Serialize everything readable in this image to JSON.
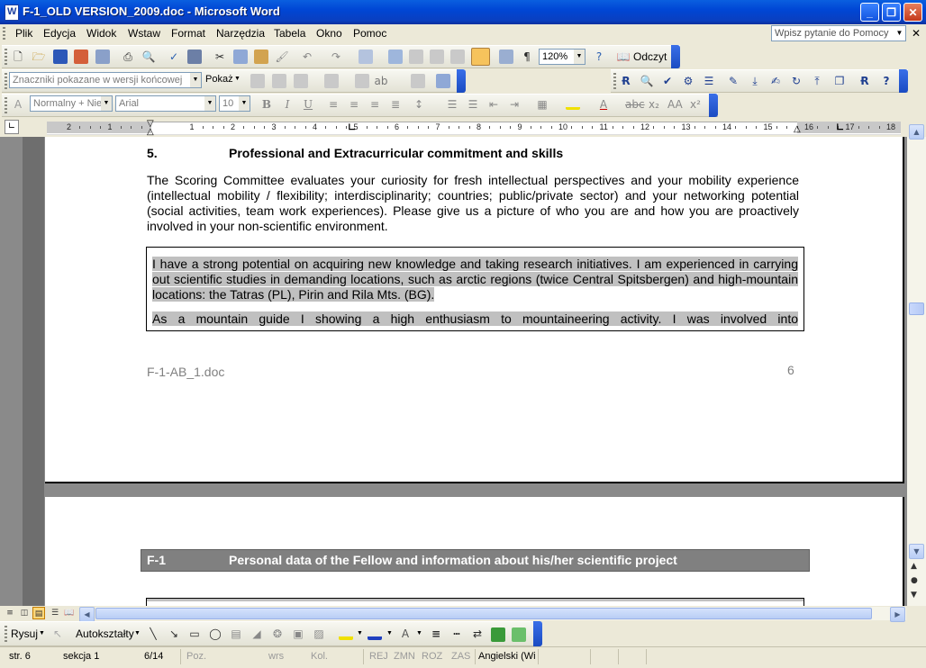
{
  "window": {
    "title": "F-1_OLD VERSION_2009.doc - Microsoft Word",
    "minimize": "_",
    "maximize": "❐",
    "close": "✕"
  },
  "menu": {
    "items": [
      "Plik",
      "Edycja",
      "Widok",
      "Wstaw",
      "Format",
      "Narzędzia",
      "Tabela",
      "Okno",
      "Pomoc"
    ],
    "help_placeholder": "Wpisz pytanie do Pomocy"
  },
  "standard_toolbar": {
    "zoom": "120%",
    "read_label": "Odczyt"
  },
  "reviewing_toolbar": {
    "markup_combo": "Znaczniki pokazane w wersji końcowej",
    "show_label": "Pokaż"
  },
  "formatting_toolbar": {
    "style": "Normalny + Nie",
    "font": "Arial",
    "size": "10",
    "bold": "B",
    "italic": "I",
    "underline": "U"
  },
  "ruler": {
    "numbers": [
      "2",
      "1",
      "1",
      "2",
      "3",
      "4",
      "5",
      "6",
      "7",
      "8",
      "9",
      "10",
      "11",
      "12",
      "13",
      "14",
      "15",
      "16",
      "17",
      "18"
    ]
  },
  "document": {
    "section_number": "5.",
    "section_heading": "Professional and Extracurricular commitment and skills",
    "intro": "The Scoring Committee evaluates your curiosity for fresh intellectual perspectives and your mobility experience (intellectual mobility / flexibility; interdisciplinarity; countries; public/private sector) and your networking potential (social activities, team work experiences). Please give us a picture of who you are and how you are proactively involved in your non-scientific environment.",
    "answer_para1": "I have a strong potential on acquiring new knowledge and taking research initiatives. I am experienced in carrying out scientific studies in demanding locations, such as arctic regions (twice Central Spitsbergen) and high-mountain locations: the Tatras (PL), Pirin and Rila Mts. (BG).",
    "answer_para2": "As a mountain guide I showing a high enthusiasm to mountaineering activity. I was involved into",
    "footer_file": "F-1-AB_1.doc",
    "footer_page": "6",
    "next_code": "F-1",
    "next_heading": "Personal data of the Fellow and information about his/her scientific project"
  },
  "drawing_toolbar": {
    "draw_label": "Rysuj",
    "autoshapes_label": "Autokształty"
  },
  "status": {
    "page": "str. 6",
    "section": "sekcja  1",
    "pages": "6/14",
    "pos": "Poz.",
    "line": "wrs",
    "col": "Kol.",
    "rec": "REJ",
    "trk": "ZMN",
    "ext": "ROZ",
    "ovr": "ZAS",
    "language": "Angielski (Wi"
  }
}
